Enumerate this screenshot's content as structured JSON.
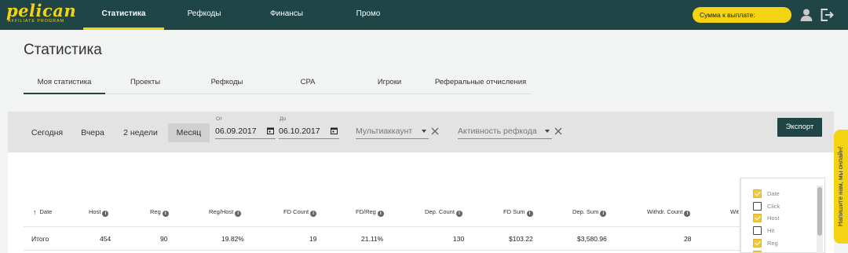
{
  "brand": {
    "name": "pelican",
    "tagline": "AFFILIATE PROGRAM"
  },
  "nav": {
    "items": [
      {
        "label": "Статистика",
        "active": true
      },
      {
        "label": "Рефкоды",
        "active": false
      },
      {
        "label": "Финансы",
        "active": false
      },
      {
        "label": "Промо",
        "active": false
      }
    ],
    "payout_label": "Сумма к выплате:",
    "icons": [
      "user-icon",
      "logout-icon"
    ]
  },
  "page": {
    "title": "Статистика"
  },
  "tabs": [
    {
      "label": "Моя статистика",
      "active": true
    },
    {
      "label": "Проекты",
      "active": false
    },
    {
      "label": "Рефкоды",
      "active": false
    },
    {
      "label": "CPA",
      "active": false
    },
    {
      "label": "Игроки",
      "active": false
    },
    {
      "label": "Реферальные отчисления",
      "active": false
    }
  ],
  "filters": {
    "periods": [
      {
        "label": "Сегодня",
        "active": false
      },
      {
        "label": "Вчера",
        "active": false
      },
      {
        "label": "2 недели",
        "active": false
      },
      {
        "label": "Месяц",
        "active": true
      }
    ],
    "from_label": "От",
    "from_value": "06.09.2017",
    "to_label": "До",
    "to_value": "06.10.2017",
    "multiaccount_placeholder": "Мультиаккаунт",
    "refcode_activity_placeholder": "Активность рефкода",
    "export_label": "Экспорт"
  },
  "table": {
    "columns": [
      "Date",
      "Host",
      "Reg",
      "Reg/Host",
      "FD Count",
      "FD/Reg",
      "Dep. Count",
      "FD Sum",
      "Dep. Sum",
      "Withdr. Count",
      "Wit"
    ],
    "sort_column": "Date",
    "total_row": [
      "Итого",
      "454",
      "90",
      "19.82%",
      "19",
      "21.11%",
      "130",
      "$103.22",
      "$3,580.96",
      "28",
      ""
    ]
  },
  "column_chooser": [
    {
      "label": "Date",
      "checked": true
    },
    {
      "label": "Click",
      "checked": false
    },
    {
      "label": "Host",
      "checked": true
    },
    {
      "label": "Hit",
      "checked": false
    },
    {
      "label": "Reg",
      "checked": true
    },
    {
      "label": "",
      "checked": true
    }
  ],
  "chat": {
    "label": "Напишите нам, мы онлайн!"
  },
  "colors": {
    "primary": "#1f4546",
    "accent": "#f4d312",
    "checkbox": "#f1c83a"
  }
}
